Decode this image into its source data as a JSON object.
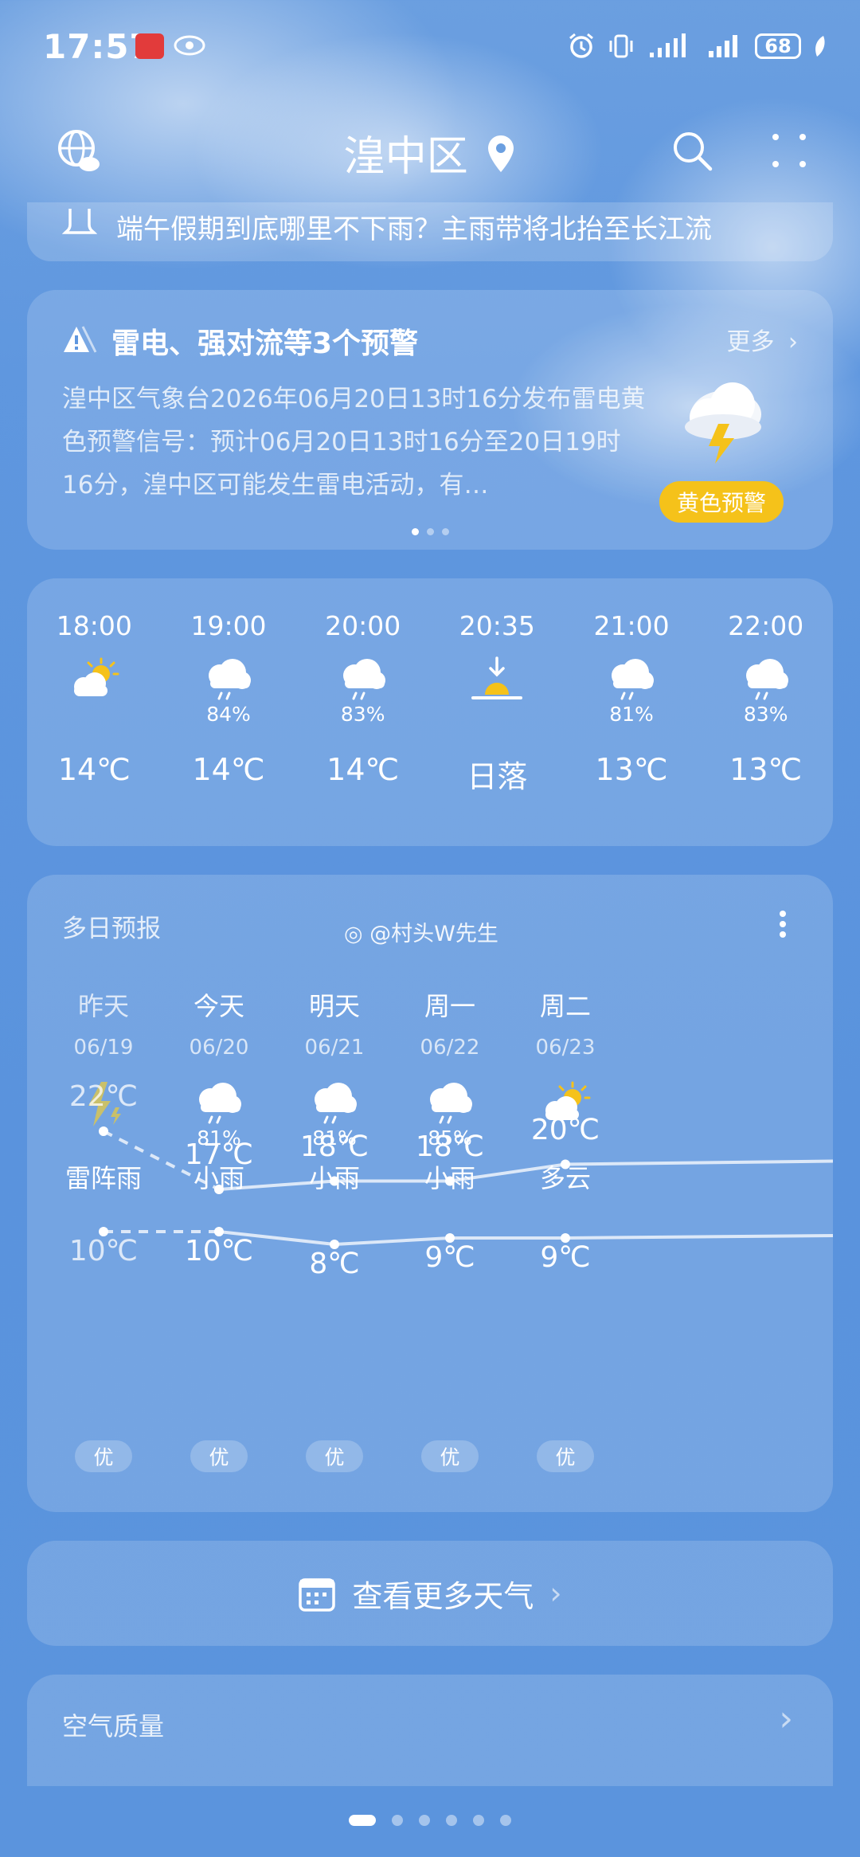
{
  "status_bar": {
    "time": "17:57",
    "battery": "68"
  },
  "header": {
    "city": "湟中区"
  },
  "news": {
    "text": "端午假期到底哪里不下雨？主雨带将北抬至长江流"
  },
  "alert": {
    "title": "雷电、强对流等3个预警",
    "more": "更多",
    "body": "湟中区气象台2026年06月20日13时16分发布雷电黄色预警信号：预计06月20日13时16分至20日19时16分，湟中区可能发生雷电活动，有…",
    "badge": "黄色预警",
    "badge_color": "#f5c21a"
  },
  "hourly": [
    {
      "time": "18:00",
      "icon": "partly-cloudy-icon",
      "precip": "",
      "value": "14℃"
    },
    {
      "time": "19:00",
      "icon": "rain-icon",
      "precip": "84%",
      "value": "14℃"
    },
    {
      "time": "20:00",
      "icon": "rain-icon",
      "precip": "83%",
      "value": "14℃"
    },
    {
      "time": "20:35",
      "icon": "sunset-icon",
      "precip": "",
      "value": "日落"
    },
    {
      "time": "21:00",
      "icon": "rain-icon",
      "precip": "81%",
      "value": "13℃"
    },
    {
      "time": "22:00",
      "icon": "rain-icon",
      "precip": "83%",
      "value": "13℃"
    }
  ],
  "multi_day": {
    "title": "多日预报",
    "watermark": "@村头W先生",
    "days": [
      {
        "name": "昨天",
        "date": "06/19",
        "icon": "thunder-icon",
        "precip": "",
        "cond": "雷阵雨",
        "high": "22℃",
        "low": "10℃",
        "aqi": "优"
      },
      {
        "name": "今天",
        "date": "06/20",
        "icon": "rain-icon",
        "precip": "81%",
        "cond": "小雨",
        "high": "17℃",
        "low": "10℃",
        "aqi": "优"
      },
      {
        "name": "明天",
        "date": "06/21",
        "icon": "rain-icon",
        "precip": "81%",
        "cond": "小雨",
        "high": "18℃",
        "low": "8℃",
        "aqi": "优"
      },
      {
        "name": "周一",
        "date": "06/22",
        "icon": "rain-icon",
        "precip": "85%",
        "cond": "小雨",
        "high": "18℃",
        "low": "9℃",
        "aqi": "优"
      },
      {
        "name": "周二",
        "date": "06/23",
        "icon": "partly-cloudy-icon",
        "precip": "",
        "cond": "多云",
        "high": "20℃",
        "low": "9℃",
        "aqi": "优"
      }
    ]
  },
  "more_weather": {
    "label": "查看更多天气"
  },
  "air_quality": {
    "title": "空气质量"
  }
}
